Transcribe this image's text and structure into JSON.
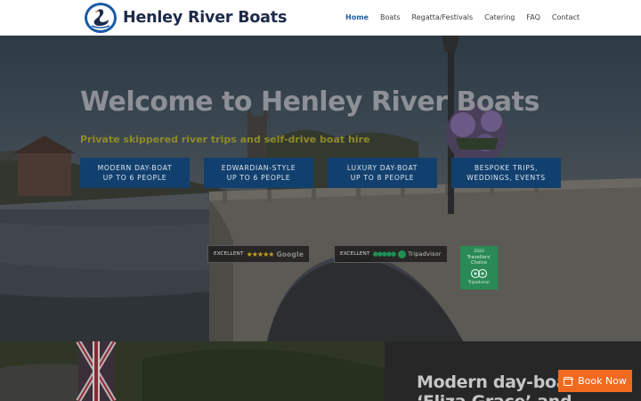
{
  "header": {
    "logo_text": "Henley River Boats",
    "nav": [
      {
        "label": "Home",
        "active": true
      },
      {
        "label": "Boats",
        "active": false
      },
      {
        "label": "Regatta/Festivals",
        "active": false
      },
      {
        "label": "Catering",
        "active": false
      },
      {
        "label": "FAQ",
        "active": false
      },
      {
        "label": "Contact",
        "active": false
      }
    ]
  },
  "hero": {
    "title": "Welcome to Henley River Boats",
    "subtitle": "Private skippered river trips and self-drive boat hire",
    "ctas": [
      {
        "line1": "MODERN DAY-BOAT",
        "line2": "UP TO 6 PEOPLE"
      },
      {
        "line1": "EDWARDIAN-STYLE",
        "line2": "UP TO 6 PEOPLE"
      },
      {
        "line1": "LUXURY DAY-BOAT",
        "line2": "UP TO 8 PEOPLE"
      },
      {
        "line1": "BESPOKE TRIPS,",
        "line2": "WEDDINGS, EVENTS"
      }
    ],
    "badges": {
      "google": {
        "label": "EXCELLENT",
        "stars": "★★★★★",
        "brand": "Google"
      },
      "tripadvisor": {
        "label": "EXCELLENT",
        "dots": "●●●●●",
        "brand": "Tripadvisor"
      }
    },
    "travellers_choice": {
      "year": "2023",
      "line1": "Travellers'",
      "line2": "Choice",
      "brand": "Tripadvisor"
    }
  },
  "lower": {
    "heading_line1": "Modern day-boat",
    "heading_line2": "‘Eliza Grace’ and"
  },
  "book_button": {
    "label": "Book Now"
  },
  "colors": {
    "accent_blue": "#12406e",
    "nav_active": "#1c5fa8",
    "book_orange": "#f26a1e"
  }
}
